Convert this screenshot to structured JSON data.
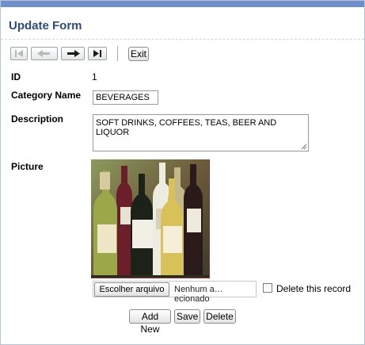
{
  "form": {
    "title": "Update Form",
    "toolbar": {
      "first_icon": "first-record-icon",
      "prev_icon": "previous-record-icon",
      "next_icon": "next-record-icon",
      "last_icon": "last-record-icon",
      "exit_label": "Exit"
    },
    "fields": {
      "id_label": "ID",
      "id_value": "1",
      "category_label": "Category Name",
      "category_value": "BEVERAGES",
      "description_label": "Description",
      "description_value": "SOFT DRINKS, COFFEES, TEAS, BEER AND LIQUOR",
      "picture_label": "Picture"
    },
    "file_input": {
      "button_label": "Escolher arquivo",
      "filename": "Nenhum a…ecionado"
    },
    "delete_checkbox": {
      "checked": false,
      "label": "Delete this record"
    },
    "actions": {
      "add_new": "Add New",
      "save": "Save",
      "delete": "Delete"
    },
    "colors": {
      "header_bar": "#6f8fca",
      "title": "#2c4d7c"
    }
  }
}
